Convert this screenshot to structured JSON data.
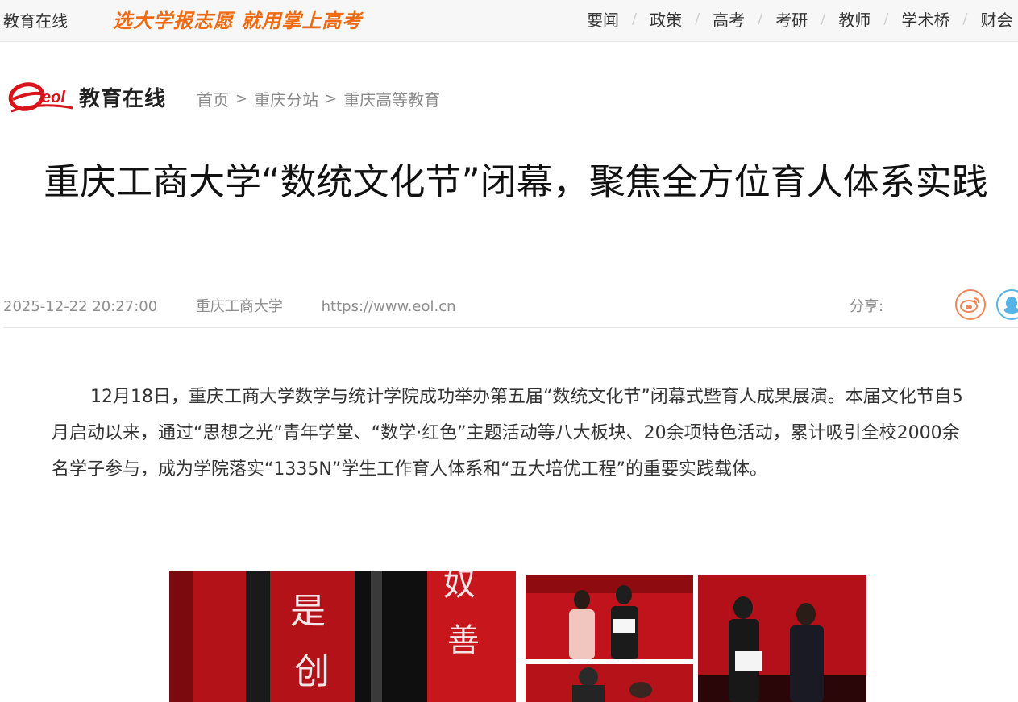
{
  "topbar": {
    "site_name": "教育在线",
    "slogan": "选大学报志愿 就用掌上高考",
    "nav": [
      "要闻",
      "政策",
      "高考",
      "考研",
      "教师",
      "学术桥",
      "财会"
    ]
  },
  "header": {
    "logo_text": "教育在线",
    "logo_mark": "eol",
    "breadcrumb": [
      "首页",
      "重庆分站",
      "重庆高等教育"
    ],
    "breadcrumb_sep": ">"
  },
  "article": {
    "title": "重庆工商大学“数统文化节”闭幕，聚焦全方位育人体系实践",
    "date": "2025-12-22 20:27:00",
    "source": "重庆工商大学",
    "url": "https://www.eol.cn",
    "share_label": "分享:",
    "paragraph": "12月18日，重庆工商大学数学与统计学院成功举办第五届“数统文化节”闭幕式暨育人成果展演。本届文化节自5月启动以来，通过“思想之光”青年学堂、“数学·红色”主题活动等八大板块、20余项特色活动，累计吸引全校2000余名学子参与，成为学院落实“1335N”学生工作育人体系和“五大培优工程”的重要实践载体。"
  },
  "colors": {
    "slogan": "#ef6a11",
    "logo_red": "#d8141a",
    "weibo": "#f0875a",
    "qq": "#55b3e6"
  },
  "icons": {
    "share_weibo": "weibo-icon",
    "share_qq": "qq-icon"
  }
}
